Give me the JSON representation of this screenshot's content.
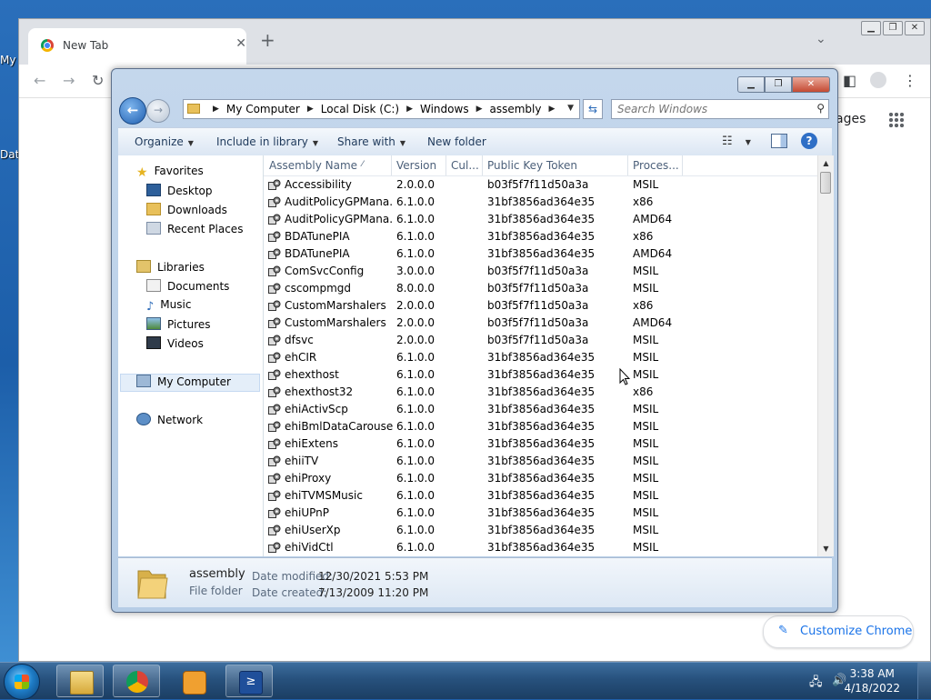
{
  "desktop": {
    "icon_labels": [
      "My",
      "Dat"
    ]
  },
  "chrome": {
    "tab_title": "New Tab",
    "tab_close": "✕",
    "new_tab": "+",
    "partial_text": "ages",
    "customize_label": "Customize Chrome"
  },
  "explorer": {
    "breadcrumbs": [
      "My Computer",
      "Local Disk (C:)",
      "Windows",
      "assembly"
    ],
    "search_placeholder": "Search Windows",
    "commands": {
      "organize": "Organize",
      "include_in_library": "Include in library",
      "share_with": "Share with",
      "new_folder": "New folder"
    },
    "nav": {
      "favorites": "Favorites",
      "desktop": "Desktop",
      "downloads": "Downloads",
      "recent_places": "Recent Places",
      "libraries": "Libraries",
      "documents": "Documents",
      "music": "Music",
      "pictures": "Pictures",
      "videos": "Videos",
      "my_computer": "My Computer",
      "network": "Network"
    },
    "columns": [
      "Assembly Name",
      "Version",
      "Cul...",
      "Public Key Token",
      "Proces..."
    ],
    "rows": [
      [
        "Accessibility",
        "2.0.0.0",
        "",
        "b03f5f7f11d50a3a",
        "MSIL"
      ],
      [
        "AuditPolicyGPMana...",
        "6.1.0.0",
        "",
        "31bf3856ad364e35",
        "x86"
      ],
      [
        "AuditPolicyGPMana...",
        "6.1.0.0",
        "",
        "31bf3856ad364e35",
        "AMD64"
      ],
      [
        "BDATunePIA",
        "6.1.0.0",
        "",
        "31bf3856ad364e35",
        "x86"
      ],
      [
        "BDATunePIA",
        "6.1.0.0",
        "",
        "31bf3856ad364e35",
        "AMD64"
      ],
      [
        "ComSvcConfig",
        "3.0.0.0",
        "",
        "b03f5f7f11d50a3a",
        "MSIL"
      ],
      [
        "cscompmgd",
        "8.0.0.0",
        "",
        "b03f5f7f11d50a3a",
        "MSIL"
      ],
      [
        "CustomMarshalers",
        "2.0.0.0",
        "",
        "b03f5f7f11d50a3a",
        "x86"
      ],
      [
        "CustomMarshalers",
        "2.0.0.0",
        "",
        "b03f5f7f11d50a3a",
        "AMD64"
      ],
      [
        "dfsvc",
        "2.0.0.0",
        "",
        "b03f5f7f11d50a3a",
        "MSIL"
      ],
      [
        "ehCIR",
        "6.1.0.0",
        "",
        "31bf3856ad364e35",
        "MSIL"
      ],
      [
        "ehexthost",
        "6.1.0.0",
        "",
        "31bf3856ad364e35",
        "MSIL"
      ],
      [
        "ehexthost32",
        "6.1.0.0",
        "",
        "31bf3856ad364e35",
        "x86"
      ],
      [
        "ehiActivScp",
        "6.1.0.0",
        "",
        "31bf3856ad364e35",
        "MSIL"
      ],
      [
        "ehiBmlDataCarousel",
        "6.1.0.0",
        "",
        "31bf3856ad364e35",
        "MSIL"
      ],
      [
        "ehiExtens",
        "6.1.0.0",
        "",
        "31bf3856ad364e35",
        "MSIL"
      ],
      [
        "ehiiTV",
        "6.1.0.0",
        "",
        "31bf3856ad364e35",
        "MSIL"
      ],
      [
        "ehiProxy",
        "6.1.0.0",
        "",
        "31bf3856ad364e35",
        "MSIL"
      ],
      [
        "ehiTVMSMusic",
        "6.1.0.0",
        "",
        "31bf3856ad364e35",
        "MSIL"
      ],
      [
        "ehiUPnP",
        "6.1.0.0",
        "",
        "31bf3856ad364e35",
        "MSIL"
      ],
      [
        "ehiUserXp",
        "6.1.0.0",
        "",
        "31bf3856ad364e35",
        "MSIL"
      ],
      [
        "ehiVidCtl",
        "6.1.0.0",
        "",
        "31bf3856ad364e35",
        "MSIL"
      ]
    ],
    "details": {
      "name": "assembly",
      "type": "File folder",
      "modified_label": "Date modified:",
      "modified_value": "12/30/2021 5:53 PM",
      "created_label": "Date created:",
      "created_value": "7/13/2009 11:20 PM"
    }
  },
  "taskbar": {
    "time": "3:38 AM",
    "date": "4/18/2022"
  }
}
